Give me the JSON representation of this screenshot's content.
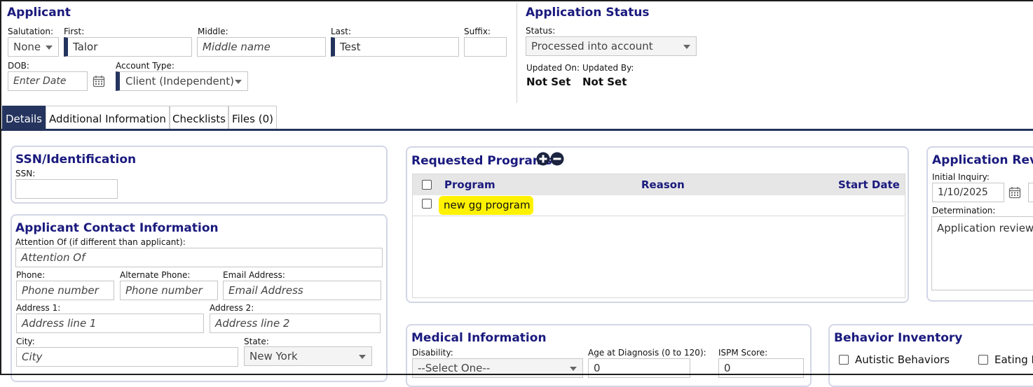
{
  "applicant": {
    "title": "Applicant",
    "salutation_label": "Salutation:",
    "salutation_value": "None",
    "first_label": "First:",
    "first_value": "Talor",
    "middle_label": "Middle:",
    "middle_placeholder": "Middle name",
    "last_label": "Last:",
    "last_value": "Test",
    "suffix_label": "Suffix:",
    "dob_label": "DOB:",
    "dob_placeholder": "Enter Date",
    "account_type_label": "Account Type:",
    "account_type_value": "Client (Independent)"
  },
  "status": {
    "title": "Application Status",
    "status_label": "Status:",
    "status_value": "Processed into account",
    "updated_on_label": "Updated On:",
    "updated_on_value": "Not Set",
    "updated_by_label": "Updated By:",
    "updated_by_value": "Not Set"
  },
  "tabs": [
    {
      "label": "Details"
    },
    {
      "label": "Additional Information"
    },
    {
      "label": "Checklists"
    },
    {
      "label": "Files (0)"
    }
  ],
  "ssn": {
    "title": "SSN/Identification",
    "ssn_label": "SSN:"
  },
  "contact": {
    "title": "Applicant Contact Information",
    "attention_label": "Attention Of (if different than applicant):",
    "attention_placeholder": "Attention Of",
    "phone_label": "Phone:",
    "phone_placeholder": "Phone number",
    "alt_phone_label": "Alternate Phone:",
    "alt_phone_placeholder": "Phone number",
    "email_label": "Email Address:",
    "email_placeholder": "Email Address",
    "address1_label": "Address 1:",
    "address1_placeholder": "Address line 1",
    "address2_label": "Address 2:",
    "address2_placeholder": "Address line 2",
    "city_label": "City:",
    "city_placeholder": "City",
    "state_label": "State:",
    "state_value": "New York"
  },
  "programs": {
    "title": "Requested Programs",
    "col_program": "Program",
    "col_reason": "Reason",
    "col_start": "Start Date",
    "rows": [
      {
        "program": "new gg program",
        "reason": "",
        "start": ""
      }
    ]
  },
  "review": {
    "title": "Application Revie",
    "initial_inquiry_label": "Initial Inquiry:",
    "initial_inquiry_value": "1/10/2025",
    "determination_label": "Determination:",
    "determination_value": "Application review"
  },
  "medical": {
    "title": "Medical Information",
    "disability_label": "Disability:",
    "disability_value": "--Select One--",
    "age_label": "Age at Diagnosis (0 to 120):",
    "age_value": "0",
    "ispm_label": "ISPM Score:",
    "ispm_value": "0"
  },
  "behavior": {
    "title": "Behavior Inventory",
    "items": [
      {
        "label": "Autistic Behaviors"
      },
      {
        "label": "Eating D"
      }
    ]
  },
  "colors": {
    "heading": "#1a1a7e",
    "accent": "#24345e",
    "highlight": "#fff200"
  }
}
